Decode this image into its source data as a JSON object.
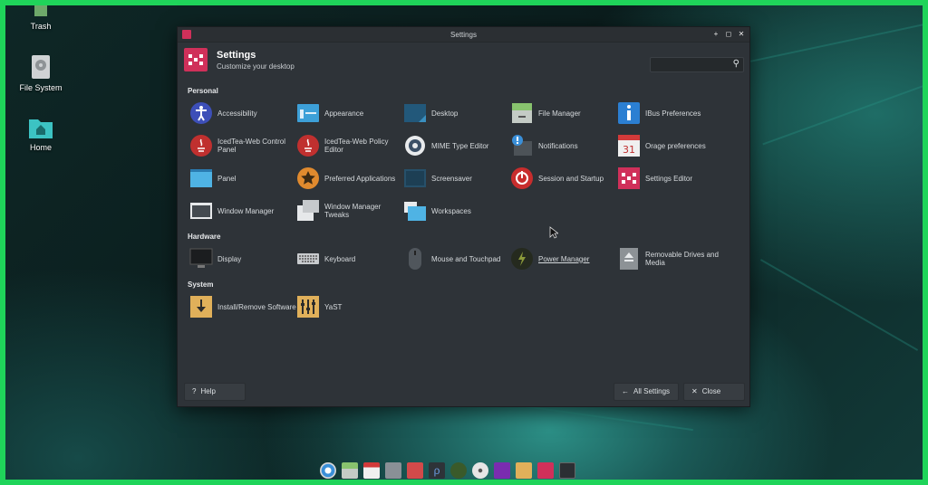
{
  "desktop_icons": [
    {
      "label": "Trash",
      "icon": "trash-icon"
    },
    {
      "label": "File System",
      "icon": "drive-icon"
    },
    {
      "label": "Home",
      "icon": "home-folder-icon"
    }
  ],
  "window": {
    "title": "Settings",
    "controls": [
      "+",
      "◻",
      "✕"
    ],
    "header_title": "Settings",
    "header_subtitle": "Customize your desktop",
    "search_placeholder": ""
  },
  "sections": {
    "personal": "Personal",
    "hardware": "Hardware",
    "system": "System"
  },
  "personal_items": [
    {
      "label": "Accessibility",
      "icon": "accessibility-icon"
    },
    {
      "label": "Appearance",
      "icon": "appearance-icon"
    },
    {
      "label": "Desktop",
      "icon": "desktop-icon"
    },
    {
      "label": "File Manager",
      "icon": "file-manager-icon"
    },
    {
      "label": "IBus Preferences",
      "icon": "ibus-icon"
    },
    {
      "label": "IcedTea-Web Control Panel",
      "icon": "java-icon"
    },
    {
      "label": "IcedTea-Web Policy Editor",
      "icon": "java-icon"
    },
    {
      "label": "MIME Type Editor",
      "icon": "mime-gear-icon"
    },
    {
      "label": "Notifications",
      "icon": "notifications-icon"
    },
    {
      "label": "Orage preferences",
      "icon": "calendar-icon"
    },
    {
      "label": "Panel",
      "icon": "panel-icon"
    },
    {
      "label": "Preferred Applications",
      "icon": "star-icon"
    },
    {
      "label": "Screensaver",
      "icon": "screensaver-icon"
    },
    {
      "label": "Session and Startup",
      "icon": "power-icon"
    },
    {
      "label": "Settings Editor",
      "icon": "settings-editor-icon"
    },
    {
      "label": "Window Manager",
      "icon": "window-manager-icon"
    },
    {
      "label": "Window Manager Tweaks",
      "icon": "window-tweaks-icon"
    },
    {
      "label": "Workspaces",
      "icon": "workspaces-icon"
    }
  ],
  "hardware_items": [
    {
      "label": "Display",
      "icon": "display-icon"
    },
    {
      "label": "Keyboard",
      "icon": "keyboard-icon"
    },
    {
      "label": "Mouse and Touchpad",
      "icon": "mouse-icon"
    },
    {
      "label": "Power Manager",
      "icon": "power-manager-icon"
    },
    {
      "label": "Removable Drives and Media",
      "icon": "removable-drive-icon"
    }
  ],
  "system_items": [
    {
      "label": "Install/Remove Software",
      "icon": "install-icon"
    },
    {
      "label": "YaST",
      "icon": "yast-icon"
    }
  ],
  "footer": {
    "help": "Help",
    "all_settings": "All Settings",
    "close": "Close"
  },
  "calendar_day": "31",
  "taskbar": [
    "browser-icon",
    "files-icon",
    "calendar-icon",
    "tasks-icon",
    "screenshot-icon",
    "package-icon",
    "owl-icon",
    "disc-icon",
    "media-icon",
    "download-icon",
    "settings-icon",
    "terminal-icon"
  ]
}
